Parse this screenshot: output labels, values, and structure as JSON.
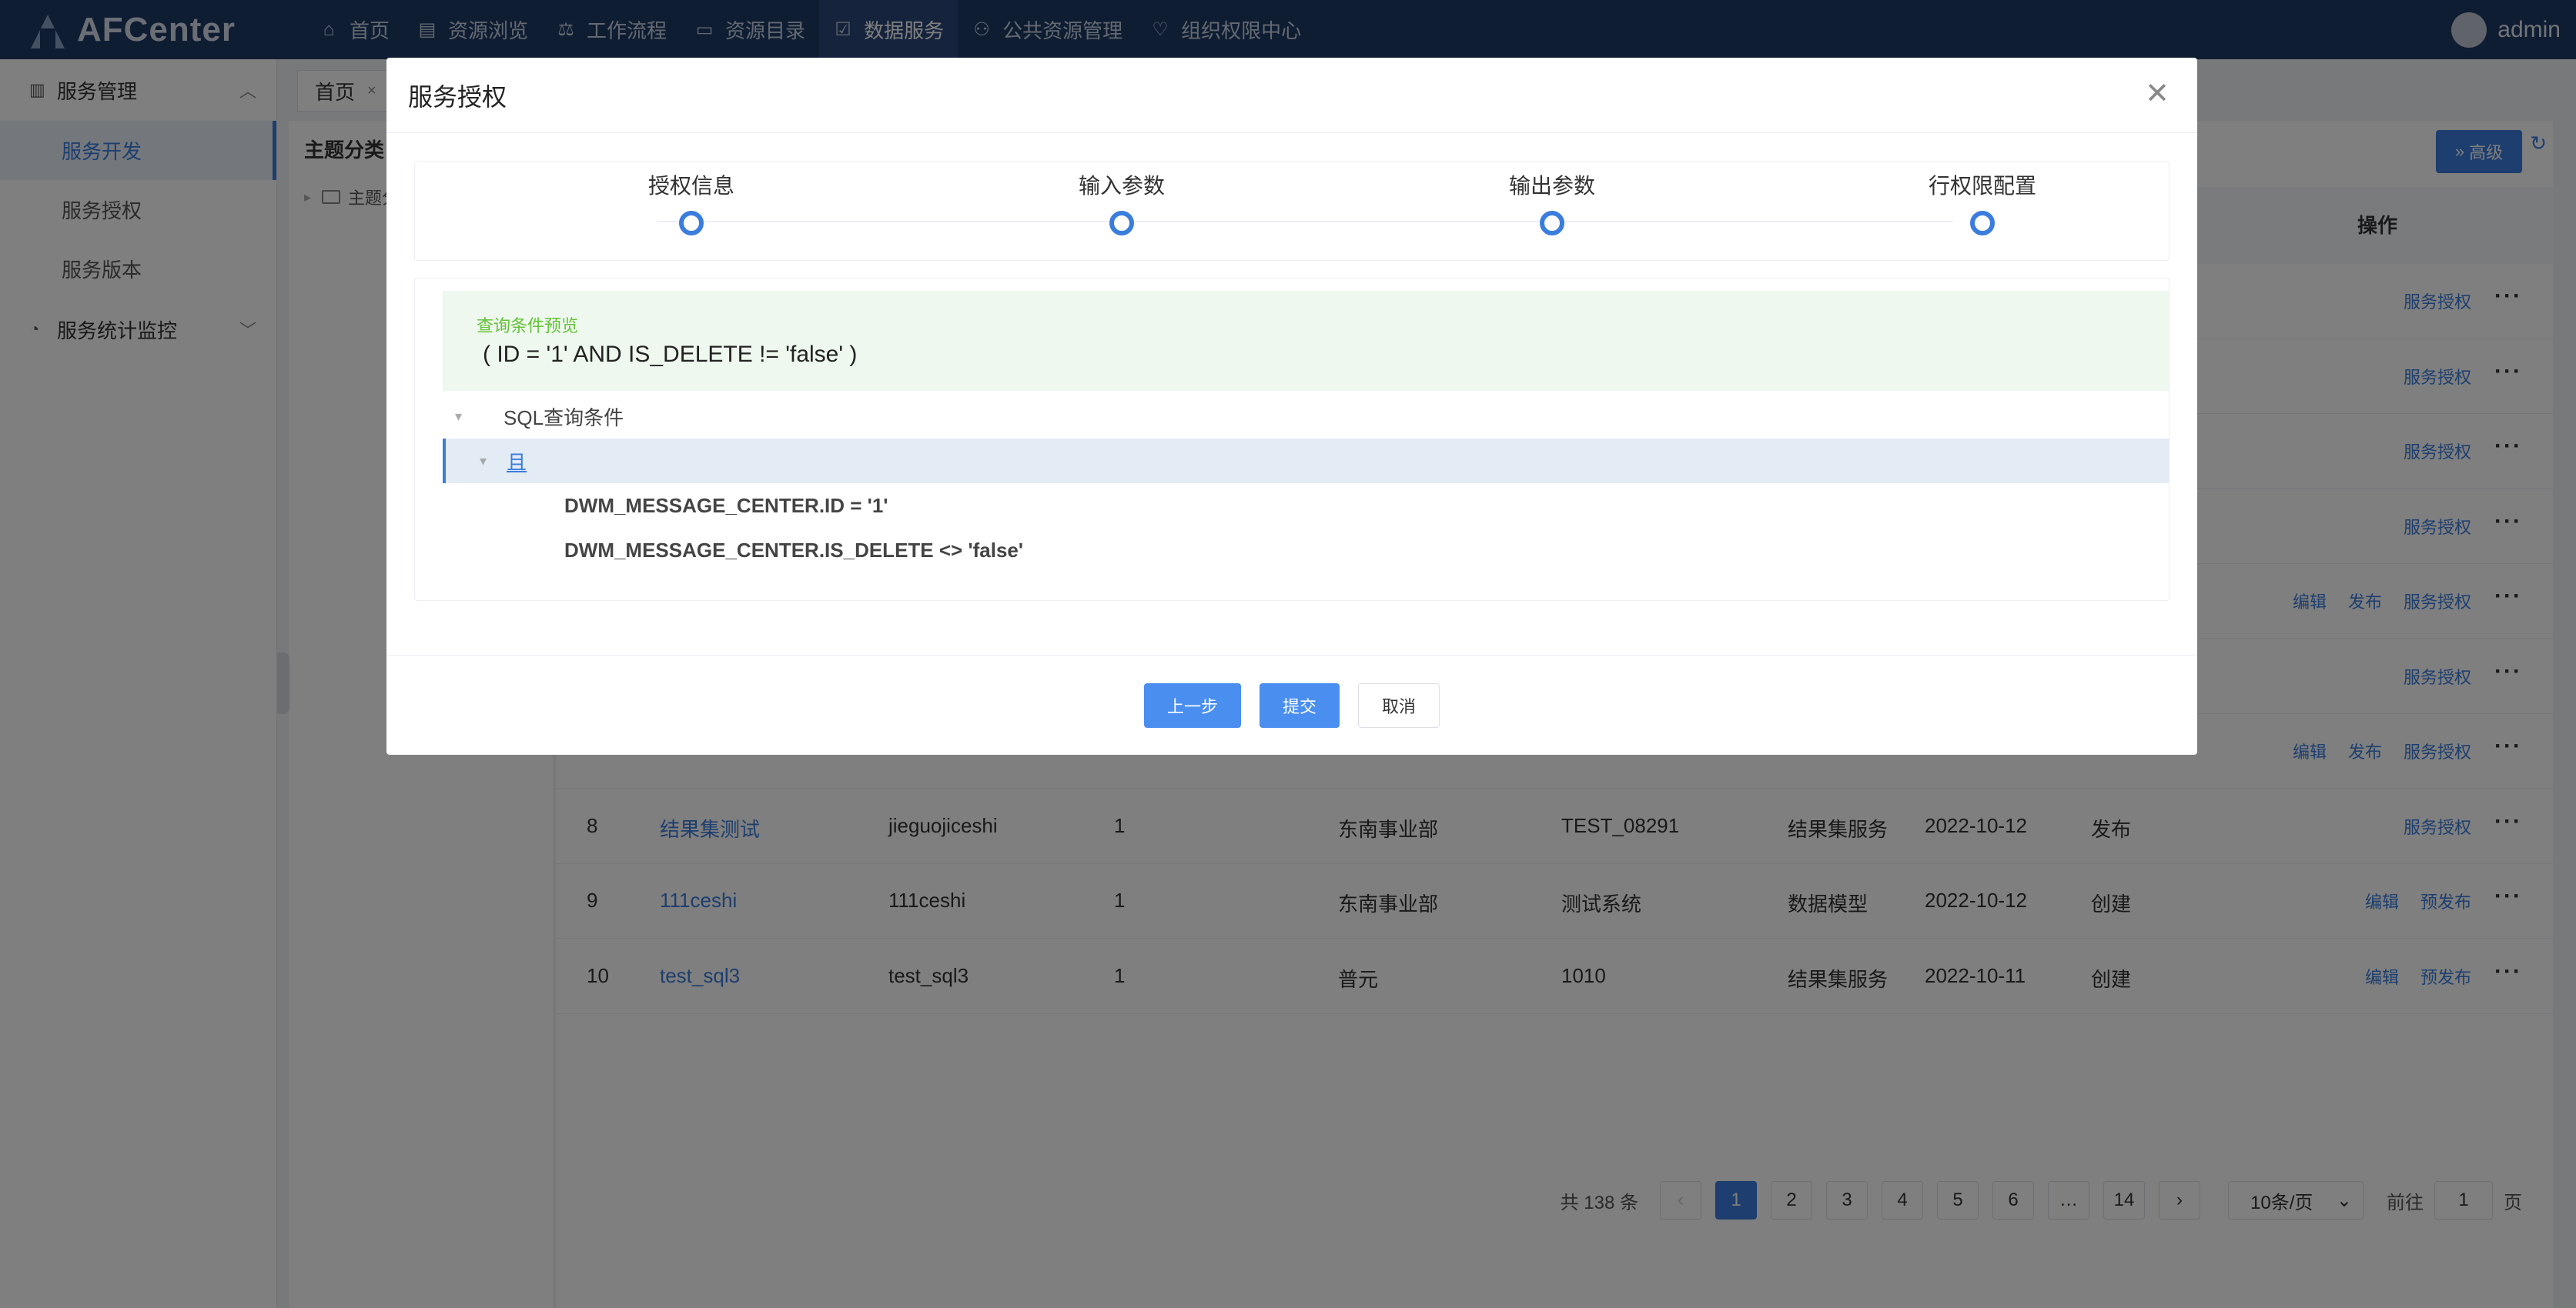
{
  "app": {
    "logo": "AFCenter",
    "user": "admin"
  },
  "nav": [
    {
      "label": "首页",
      "icon": "⌂"
    },
    {
      "label": "资源浏览",
      "icon": "▤"
    },
    {
      "label": "工作流程",
      "icon": "⚖"
    },
    {
      "label": "资源目录",
      "icon": "▭"
    },
    {
      "label": "数据服务",
      "icon": "☑"
    },
    {
      "label": "公共资源管理",
      "icon": "⚇"
    },
    {
      "label": "组织权限中心",
      "icon": "♡"
    }
  ],
  "sidebar": {
    "group1": "服务管理",
    "items": [
      "服务开发",
      "服务授权",
      "服务版本"
    ],
    "group2": "服务统计监控"
  },
  "tabs": {
    "home": "首页"
  },
  "tree": {
    "title": "主题分类",
    "node": "主题分"
  },
  "main": {
    "adv_label": "高级",
    "op_header": "操作"
  },
  "rows_ops_only": [
    {
      "ops": [
        "服务授权"
      ]
    },
    {
      "ops": [
        "服务授权"
      ]
    },
    {
      "ops": [
        "服务授权"
      ]
    },
    {
      "ops": [
        "服务授权"
      ]
    },
    {
      "ops": [
        "编辑",
        "发布",
        "服务授权"
      ]
    },
    {
      "ops": [
        "服务授权"
      ]
    },
    {
      "ops": [
        "编辑",
        "发布",
        "服务授权"
      ]
    }
  ],
  "rows": [
    {
      "no": "8",
      "name": "结果集测试",
      "code": "jieguojiceshi",
      "ver": "1",
      "dept": "东南事业部",
      "sys": "TEST_08291",
      "type": "结果集服务",
      "date": "2022-10-12",
      "status": "发布",
      "ops": [
        "服务授权"
      ]
    },
    {
      "no": "9",
      "name": "111ceshi",
      "code": "111ceshi",
      "ver": "1",
      "dept": "东南事业部",
      "sys": "测试系统",
      "type": "数据模型",
      "date": "2022-10-12",
      "status": "创建",
      "ops": [
        "编辑",
        "预发布"
      ]
    },
    {
      "no": "10",
      "name": "test_sql3",
      "code": "test_sql3",
      "ver": "1",
      "dept": "普元",
      "sys": "1010",
      "type": "结果集服务",
      "date": "2022-10-11",
      "status": "创建",
      "ops": [
        "编辑",
        "预发布"
      ]
    }
  ],
  "pager": {
    "total": "共 138 条",
    "pages": [
      "1",
      "2",
      "3",
      "4",
      "5",
      "6",
      "…",
      "14"
    ],
    "size": "10条/页",
    "goto_prefix": "前往",
    "goto_value": "1",
    "goto_suffix": "页"
  },
  "modal": {
    "title": "服务授权",
    "steps": [
      "授权信息",
      "输入参数",
      "输出参数",
      "行权限配置"
    ],
    "preview_title": "查询条件预览",
    "preview_value": "( ID = '1' AND IS_DELETE != 'false' )",
    "tree_root": "SQL查询条件",
    "tree_and": "且",
    "conditions": [
      "DWM_MESSAGE_CENTER.ID = '1'",
      "DWM_MESSAGE_CENTER.IS_DELETE <> 'false'"
    ],
    "buttons": {
      "prev": "上一步",
      "submit": "提交",
      "cancel": "取消"
    }
  }
}
